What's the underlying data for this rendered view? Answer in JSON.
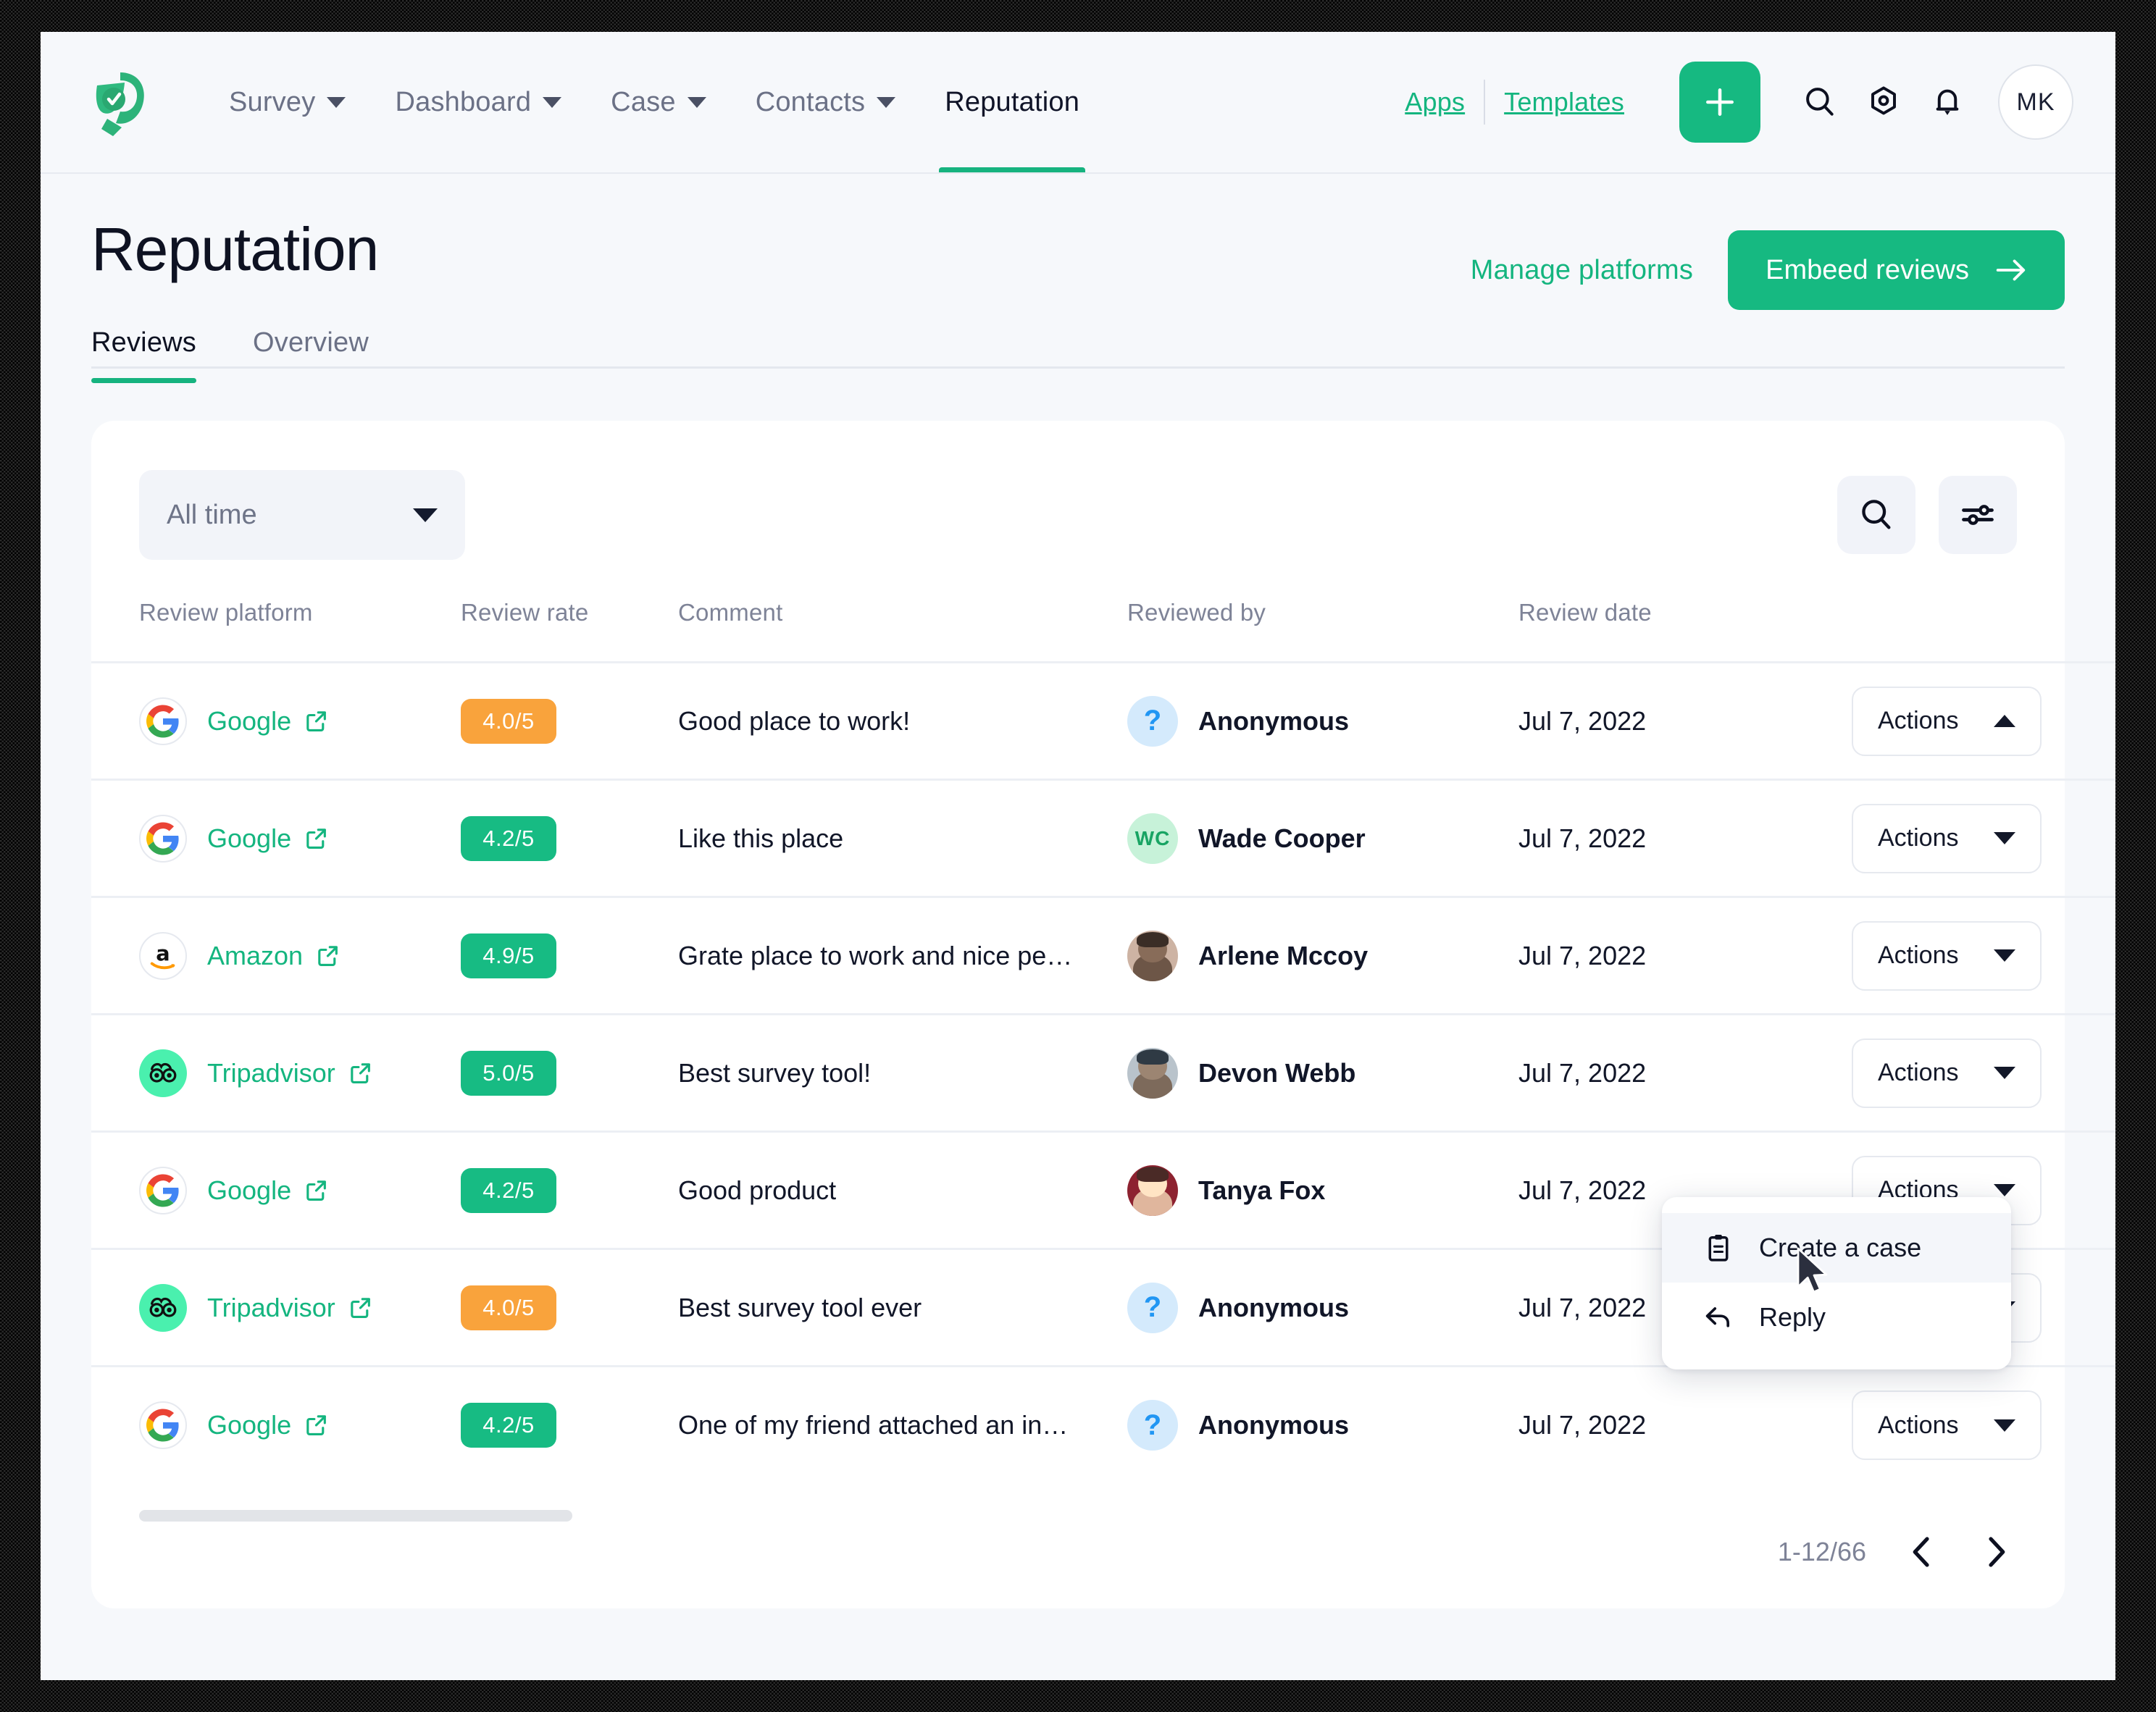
{
  "nav": {
    "logo_icon": "leaf-check-logo",
    "items": [
      {
        "label": "Survey",
        "has_caret": true,
        "active": false
      },
      {
        "label": "Dashboard",
        "has_caret": true,
        "active": false
      },
      {
        "label": "Case",
        "has_caret": true,
        "active": false
      },
      {
        "label": "Contacts",
        "has_caret": true,
        "active": false
      },
      {
        "label": "Reputation",
        "has_caret": false,
        "active": true
      }
    ],
    "apps_label": "Apps",
    "templates_label": "Templates",
    "plus_icon": "plus-icon",
    "search_icon": "search-icon",
    "settings_icon": "gear-icon",
    "bell_icon": "bell-icon",
    "avatar_initials": "MK"
  },
  "page": {
    "title": "Reputation",
    "manage_platforms_label": "Manage platforms",
    "embed_label": "Embeed reviews",
    "tabs": [
      {
        "label": "Reviews",
        "active": true
      },
      {
        "label": "Overview",
        "active": false
      }
    ]
  },
  "toolbar": {
    "time_filter_value": "All time",
    "search_icon": "search-icon",
    "filter_icon": "sliders-icon"
  },
  "table": {
    "columns": [
      "Review platform",
      "Review rate",
      "Comment",
      "Reviewed by",
      "Review date"
    ],
    "actions_label": "Actions",
    "rows": [
      {
        "platform": "Google",
        "platform_icon": "google-icon",
        "rate": "4.0/5",
        "rate_tone": "orange",
        "comment": "Good place to work!",
        "reviewer": "Anonymous",
        "avatar": "anonymous",
        "avatar_text": "?",
        "date": "Jul 7, 2022",
        "actions_open": true
      },
      {
        "platform": "Google",
        "platform_icon": "google-icon",
        "rate": "4.2/5",
        "rate_tone": "green",
        "comment": "Like this place",
        "reviewer": "Wade Cooper",
        "avatar": "initials",
        "avatar_text": "WC",
        "date": "Jul 7, 2022",
        "actions_open": false
      },
      {
        "platform": "Amazon",
        "platform_icon": "amazon-icon",
        "rate": "4.9/5",
        "rate_tone": "green",
        "comment": "Grate place to work and nice pe…",
        "reviewer": "Arlene Mccoy",
        "avatar": "photo-female-1",
        "avatar_text": "",
        "date": "Jul 7, 2022",
        "actions_open": false
      },
      {
        "platform": "Tripadvisor",
        "platform_icon": "tripadvisor-icon",
        "rate": "5.0/5",
        "rate_tone": "green",
        "comment": "Best survey tool!",
        "reviewer": "Devon Webb",
        "avatar": "photo-male-1",
        "avatar_text": "",
        "date": "Jul 7, 2022",
        "actions_open": false
      },
      {
        "platform": "Google",
        "platform_icon": "google-icon",
        "rate": "4.2/5",
        "rate_tone": "green",
        "comment": "Good product",
        "reviewer": "Tanya Fox",
        "avatar": "photo-female-2",
        "avatar_text": "",
        "date": "Jul 7, 2022",
        "actions_open": false
      },
      {
        "platform": "Tripadvisor",
        "platform_icon": "tripadvisor-icon",
        "rate": "4.0/5",
        "rate_tone": "orange",
        "comment": "Best survey tool ever",
        "reviewer": "Anonymous",
        "avatar": "anonymous",
        "avatar_text": "?",
        "date": "Jul 7, 2022",
        "actions_open": false
      },
      {
        "platform": "Google",
        "platform_icon": "google-icon",
        "rate": "4.2/5",
        "rate_tone": "green",
        "comment": "One of my friend attached an in…",
        "reviewer": "Anonymous",
        "avatar": "anonymous",
        "avatar_text": "?",
        "date": "Jul 7, 2022",
        "actions_open": false
      }
    ]
  },
  "dropdown": {
    "items": [
      {
        "label": "Create a case",
        "icon": "clipboard-icon",
        "highlighted": true
      },
      {
        "label": "Reply",
        "icon": "reply-arrow-icon",
        "highlighted": false
      }
    ]
  },
  "pagination": {
    "range": "1-12/66",
    "prev_icon": "chevron-left-icon",
    "next_icon": "chevron-right-icon"
  },
  "colors": {
    "brand_green": "#16b981",
    "link_green": "#14b57f",
    "badge_green": "#17bb83",
    "badge_orange": "#f9a33c",
    "page_bg": "#f6f8fb",
    "text_dark": "#111628",
    "text_muted": "#7e8397"
  }
}
